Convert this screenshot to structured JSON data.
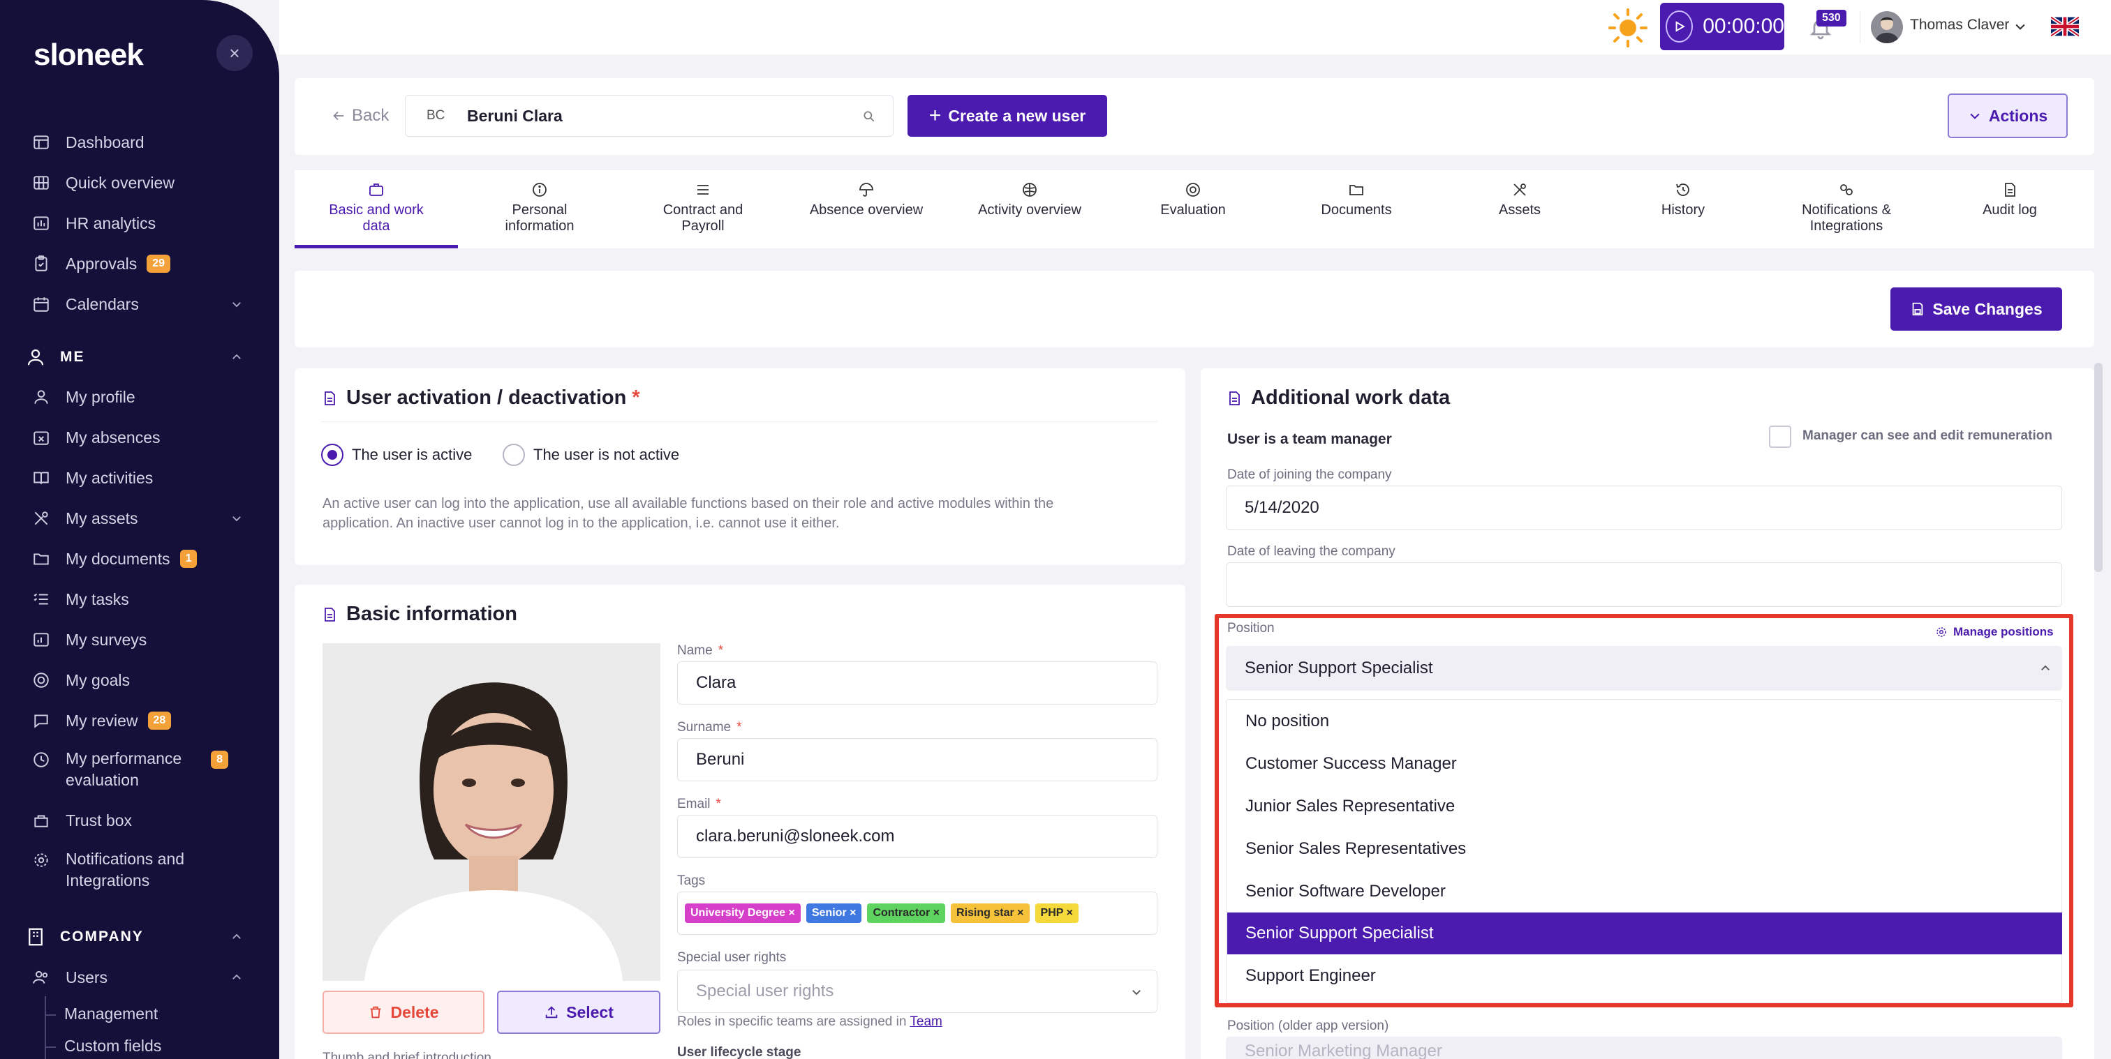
{
  "app": {
    "logo": "sloneek"
  },
  "sidebar": {
    "items": [
      {
        "label": "Dashboard",
        "icon": "dashboard-icon"
      },
      {
        "label": "Quick overview",
        "icon": "grid-icon"
      },
      {
        "label": "HR analytics",
        "icon": "chart-icon"
      },
      {
        "label": "Approvals",
        "icon": "clipboard-icon",
        "badge": "29"
      },
      {
        "label": "Calendars",
        "icon": "calendar-icon"
      }
    ],
    "me_section": "ME",
    "me_items": [
      {
        "label": "My profile"
      },
      {
        "label": "My absences"
      },
      {
        "label": "My activities"
      },
      {
        "label": "My assets"
      },
      {
        "label": "My documents",
        "badge": "1"
      },
      {
        "label": "My tasks"
      },
      {
        "label": "My surveys"
      },
      {
        "label": "My goals"
      },
      {
        "label": "My review",
        "badge": "28"
      },
      {
        "label": "My performance",
        "label2": "evaluation",
        "badge": "8"
      },
      {
        "label": "Trust box"
      },
      {
        "label": "Notifications and",
        "label2": "Integrations"
      }
    ],
    "company_section": "COMPANY",
    "users": "Users",
    "management": "Management",
    "custom_fields": "Custom fields"
  },
  "topbar": {
    "timer": "00:00:00",
    "notifications": "530",
    "user_name": "Thomas Claver"
  },
  "header": {
    "back": "Back",
    "search_initials": "BC",
    "search_value": "Beruni Clara",
    "create_user": "Create a new user",
    "actions": "Actions"
  },
  "tabs": [
    {
      "l1": "Basic and work",
      "l2": "data"
    },
    {
      "l1": "Personal",
      "l2": "information"
    },
    {
      "l1": "Contract and",
      "l2": "Payroll"
    },
    {
      "l1": "Absence overview",
      "l2": ""
    },
    {
      "l1": "Activity overview",
      "l2": ""
    },
    {
      "l1": "Evaluation",
      "l2": ""
    },
    {
      "l1": "Documents",
      "l2": ""
    },
    {
      "l1": "Assets",
      "l2": ""
    },
    {
      "l1": "History",
      "l2": ""
    },
    {
      "l1": "Notifications &",
      "l2": "Integrations"
    },
    {
      "l1": "Audit log",
      "l2": ""
    }
  ],
  "save_changes": "Save Changes",
  "activation": {
    "title": "User activation / deactivation",
    "req": "*",
    "active": "The user is active",
    "inactive": "The user is not active",
    "desc1": "An active user can log into the application, use all available functions based on their role and active modules within the",
    "desc2": "application. An inactive user cannot log in to the application, i.e. cannot use it either."
  },
  "basic": {
    "title": "Basic information",
    "delete": "Delete",
    "select": "Select",
    "name_label": "Name",
    "name": "Clara",
    "surname_label": "Surname",
    "surname": "Beruni",
    "email_label": "Email",
    "email": "clara.beruni@sloneek.com",
    "tags_label": "Tags",
    "tags": [
      {
        "label": "University Degree",
        "color": "#d63fc9"
      },
      {
        "label": "Senior",
        "color": "#3f78e0"
      },
      {
        "label": "Contractor",
        "color": "#5fd35f"
      },
      {
        "label": "Rising star",
        "color": "#f5c23a"
      },
      {
        "label": "PHP",
        "color": "#f5d83a"
      }
    ],
    "rights_label": "Special user rights",
    "rights_placeholder": "Special user rights",
    "rights_note": "Roles in specific teams are assigned in",
    "rights_link": "Team",
    "lifecycle_label": "User lifecycle stage",
    "desc_label": "Thumb and brief introduction"
  },
  "additional": {
    "title": "Additional work data",
    "team_manager": "User is a team manager",
    "manager_remun": "Manager can see and edit remuneration",
    "join_label": "Date of joining the company",
    "join_value": "5/14/2020",
    "leave_label": "Date of leaving the company",
    "position_label": "Position",
    "manage_positions": "Manage positions",
    "position_value": "Senior Support Specialist",
    "options": [
      "No position",
      "Customer Success Manager",
      "Junior Sales Representative",
      "Senior Sales Representatives",
      "Senior Software Developer",
      "Senior Support Specialist",
      "Support Engineer"
    ],
    "older_label": "Position (older app version)",
    "older_value": "Senior Marketing Manager"
  }
}
